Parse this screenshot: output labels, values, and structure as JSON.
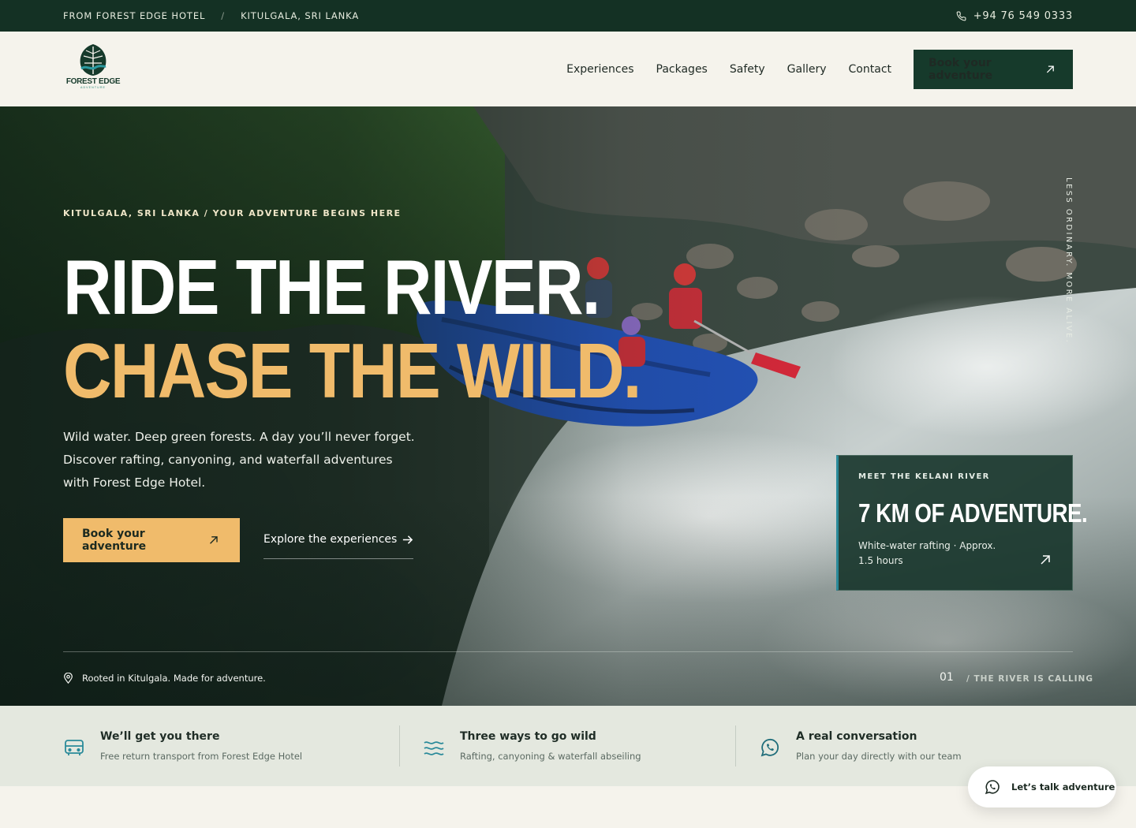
{
  "colors": {
    "forest": "#163a2b",
    "topbar": "#143124",
    "gold": "#f0bb6b",
    "cream": "#f5f3ec",
    "strip": "#e4e8df",
    "teal": "#2a8a9a"
  },
  "topbar": {
    "hotel": "FROM FOREST EDGE HOTEL",
    "separator": "/",
    "location": "KITULGALA, SRI LANKA",
    "phone_icon": "phone-icon",
    "phone": "+94 76 549 0333"
  },
  "header": {
    "logo": {
      "name": "FOREST EDGE",
      "tagline": "ADVENTURE"
    },
    "nav": [
      "Experiences",
      "Packages",
      "Safety",
      "Gallery",
      "Contact"
    ],
    "cta": "Book your adventure",
    "cta_icon": "arrow-up-right-icon"
  },
  "hero": {
    "eyebrow": "KITULGALA, SRI LANKA / YOUR ADVENTURE BEGINS HERE",
    "headline_1": "RIDE THE RIVER.",
    "headline_2": "CHASE THE WILD.",
    "lead": "Wild water. Deep green forests. A day you’ll never forget. Discover rafting, canyoning, and waterfall adventures with Forest Edge Hotel.",
    "primary_cta": "Book your adventure",
    "secondary_cta": "Explore the experiences",
    "vertical_text": "LESS ORDINARY. MORE ALIVE.",
    "card": {
      "kicker": "MEET THE KELANI RIVER",
      "title": "7 KM OF ADVENTURE.",
      "desc": "White-water rafting · Approx. 1.5 hours"
    },
    "rooted": "Rooted in Kitulgala. Made for adventure.",
    "slide_number": "01",
    "slide_caption": "/ THE RIVER IS CALLING"
  },
  "features": [
    {
      "icon": "bus-icon",
      "title": "We’ll get you there",
      "subtitle": "Free return transport from Forest Edge Hotel"
    },
    {
      "icon": "waves-icon",
      "title": "Three ways to go wild",
      "subtitle": "Rafting, canyoning & waterfall abseiling"
    },
    {
      "icon": "whatsapp-icon",
      "title": "A real conversation",
      "subtitle": "Plan your day directly with our team"
    }
  ],
  "chat": {
    "icon": "whatsapp-icon",
    "label": "Let’s talk adventure"
  }
}
